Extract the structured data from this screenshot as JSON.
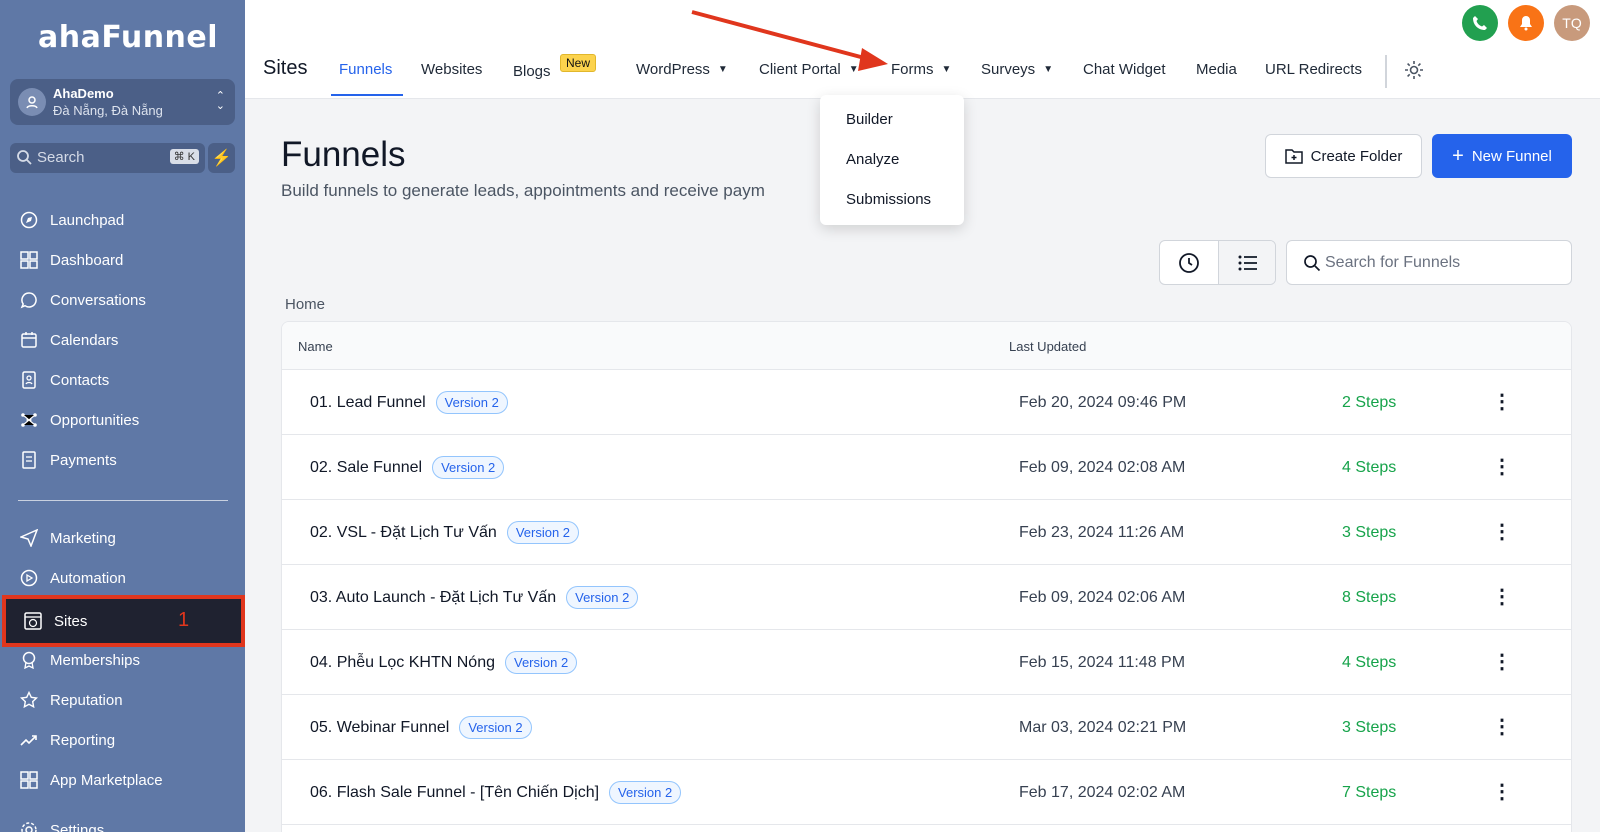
{
  "sidebar": {
    "logo": "ahaFunnel",
    "account": {
      "name": "AhaDemo",
      "location": "Đà Nẵng, Đà Nẵng"
    },
    "search": {
      "placeholder": "Search",
      "shortcut": "⌘ K"
    },
    "items": [
      {
        "label": "Launchpad",
        "icon": "rocket-icon"
      },
      {
        "label": "Dashboard",
        "icon": "grid-icon"
      },
      {
        "label": "Conversations",
        "icon": "chat-icon"
      },
      {
        "label": "Calendars",
        "icon": "calendar-icon"
      },
      {
        "label": "Contacts",
        "icon": "contacts-icon"
      },
      {
        "label": "Opportunities",
        "icon": "network-icon"
      },
      {
        "label": "Payments",
        "icon": "receipt-icon"
      },
      {
        "label": "Marketing",
        "icon": "send-icon"
      },
      {
        "label": "Automation",
        "icon": "play-circle-icon"
      },
      {
        "label": "Sites",
        "icon": "globe-window-icon",
        "active": true
      },
      {
        "label": "Memberships",
        "icon": "badge-icon"
      },
      {
        "label": "Reputation",
        "icon": "star-icon"
      },
      {
        "label": "Reporting",
        "icon": "trend-icon"
      },
      {
        "label": "App Marketplace",
        "icon": "apps-icon"
      },
      {
        "label": "Settings",
        "icon": "gear-icon"
      }
    ],
    "annotation_number": "1"
  },
  "topbar": {
    "title": "Sites",
    "tabs": [
      {
        "label": "Funnels",
        "active": true
      },
      {
        "label": "Websites"
      },
      {
        "label": "Blogs",
        "badge": "New"
      },
      {
        "label": "WordPress",
        "dropdown": true
      },
      {
        "label": "Client Portal",
        "dropdown": true
      },
      {
        "label": "Forms",
        "dropdown": true
      },
      {
        "label": "Surveys",
        "dropdown": true
      },
      {
        "label": "Chat Widget"
      },
      {
        "label": "Media"
      },
      {
        "label": "URL Redirects"
      }
    ],
    "avatar_initials": "TQ"
  },
  "forms_menu": [
    "Builder",
    "Analyze",
    "Submissions"
  ],
  "main": {
    "title": "Funnels",
    "subtitle": "Build funnels to generate leads, appointments and receive paym",
    "create_folder": "Create Folder",
    "new_funnel": "New Funnel",
    "search_placeholder": "Search for Funnels",
    "breadcrumb": "Home",
    "columns": {
      "name": "Name",
      "updated": "Last Updated"
    },
    "rows": [
      {
        "name": "01. Lead Funnel",
        "version": "Version 2",
        "updated": "Feb 20, 2024 09:46 PM",
        "steps": "2 Steps"
      },
      {
        "name": "02. Sale Funnel",
        "version": "Version 2",
        "updated": "Feb 09, 2024 02:08 AM",
        "steps": "4 Steps"
      },
      {
        "name": "02. VSL - Đặt Lịch Tư Vấn",
        "version": "Version 2",
        "updated": "Feb 23, 2024 11:26 AM",
        "steps": "3 Steps"
      },
      {
        "name": "03. Auto Launch - Đặt Lịch Tư Vấn",
        "version": "Version 2",
        "updated": "Feb 09, 2024 02:06 AM",
        "steps": "8 Steps"
      },
      {
        "name": "04. Phễu Lọc KHTN Nóng",
        "version": "Version 2",
        "updated": "Feb 15, 2024 11:48 PM",
        "steps": "4 Steps"
      },
      {
        "name": "05. Webinar Funnel",
        "version": "Version 2",
        "updated": "Mar 03, 2024 02:21 PM",
        "steps": "3 Steps"
      },
      {
        "name": "06. Flash Sale Funnel - [Tên Chiến Dịch]",
        "version": "Version 2",
        "updated": "Feb 17, 2024 02:02 AM",
        "steps": "7 Steps"
      }
    ]
  },
  "colors": {
    "sidebar": "#5f78a6",
    "accent": "#2563eb",
    "steps": "#16a34a",
    "annotation": "#e0361d"
  }
}
